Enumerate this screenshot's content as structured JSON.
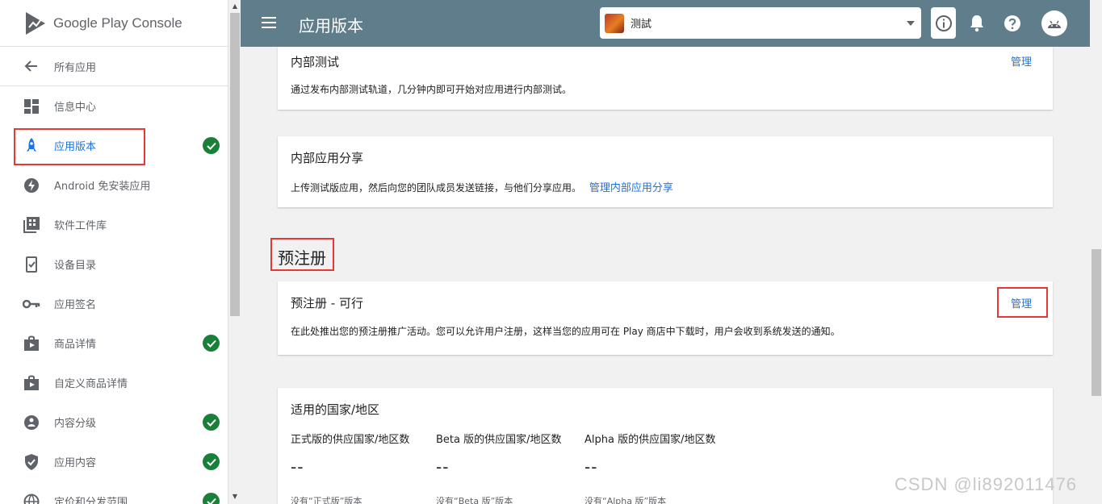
{
  "brand": {
    "name": "Google Play Console"
  },
  "sidebar": {
    "back_label": "所有应用",
    "items": [
      {
        "label": "信息中心",
        "icon": "dashboard-icon",
        "checked": false
      },
      {
        "label": "应用版本",
        "icon": "rocket-icon",
        "checked": true,
        "active": true
      },
      {
        "label": "Android 免安装应用",
        "icon": "lightning-icon",
        "checked": false
      },
      {
        "label": "软件工件库",
        "icon": "artifact-library-icon",
        "checked": false
      },
      {
        "label": "设备目录",
        "icon": "device-catalog-icon",
        "checked": false
      },
      {
        "label": "应用签名",
        "icon": "key-icon",
        "checked": false
      },
      {
        "label": "商品详情",
        "icon": "store-listing-icon",
        "checked": true
      },
      {
        "label": "自定义商品详情",
        "icon": "custom-listing-icon",
        "checked": false
      },
      {
        "label": "内容分级",
        "icon": "content-rating-icon",
        "checked": true
      },
      {
        "label": "应用内容",
        "icon": "shield-icon",
        "checked": true
      },
      {
        "label": "定价和分发范围",
        "icon": "globe-icon",
        "checked": true
      }
    ]
  },
  "topbar": {
    "title": "应用版本",
    "selected_app": "测試"
  },
  "content": {
    "internal_test": {
      "title": "内部测试",
      "manage": "管理",
      "desc": "通过发布内部测试轨道，几分钟内即可开始对应用进行内部测试。"
    },
    "internal_share": {
      "title": "内部应用分享",
      "desc": "上传测试版应用，然后向您的团队成员发送链接，与他们分享应用。",
      "link": "管理内部应用分享"
    },
    "prereg_section": "预注册",
    "prereg": {
      "title": "预注册 - 可行",
      "manage": "管理",
      "desc": "在此处推出您的预注册推广活动。您可以允许用户注册，这样当您的应用可在 Play 商店中下载时，用户会收到系统发送的通知。"
    },
    "countries": {
      "title": "适用的国家/地区",
      "columns": [
        {
          "label": "正式版的供应国家/地区数",
          "value": "--",
          "note": "没有“正式版”版本"
        },
        {
          "label": "Beta 版的供应国家/地区数",
          "value": "--",
          "note": "没有“Beta 版”版本"
        },
        {
          "label": "Alpha 版的供应国家/地区数",
          "value": "--",
          "note": "没有“Alpha 版”版本"
        }
      ]
    }
  },
  "watermark": "CSDN @li892011476",
  "colors": {
    "topbar": "#607d8b",
    "accent": "#1a73e8",
    "success": "#188038",
    "highlight": "#e53935"
  }
}
